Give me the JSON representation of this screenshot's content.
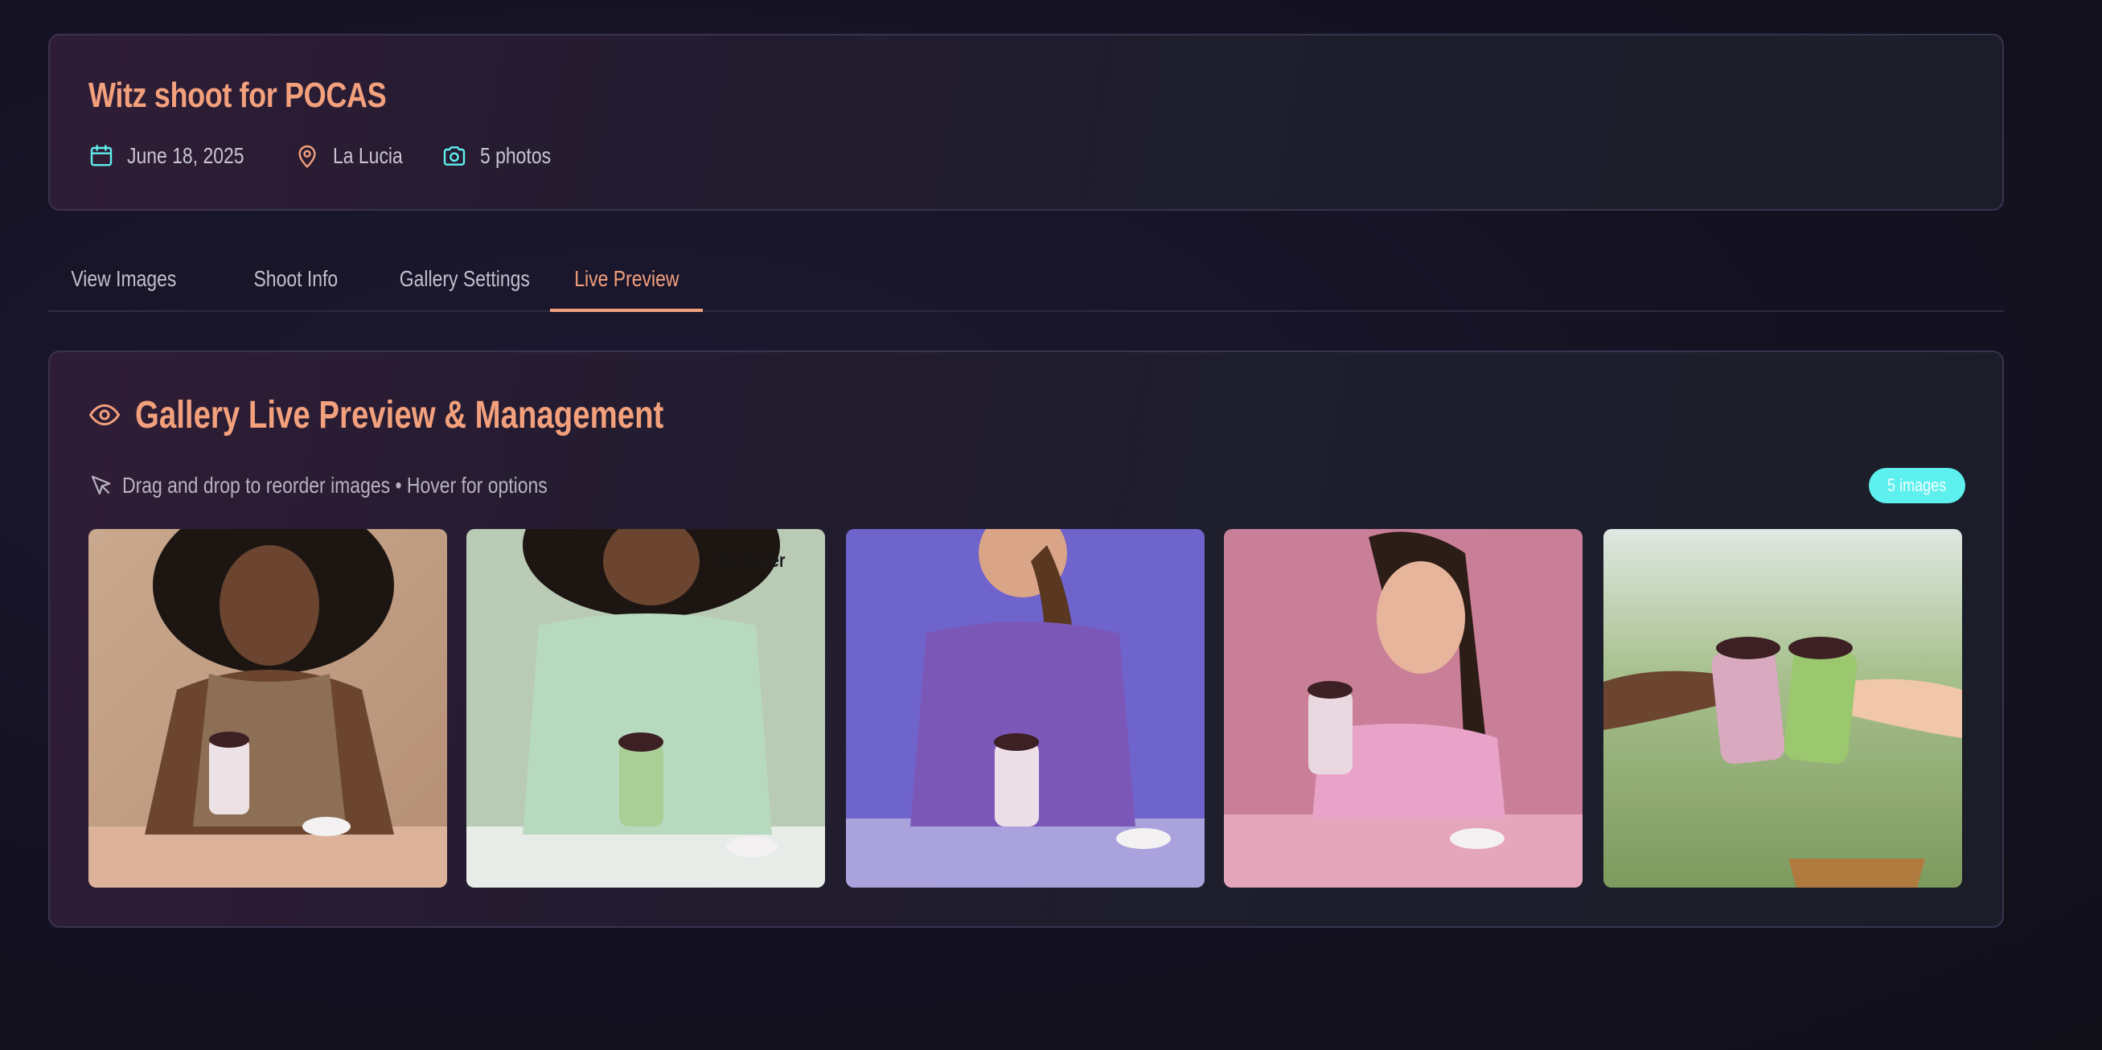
{
  "shoot": {
    "title": "Witz shoot for POCAS",
    "date": "June 18, 2025",
    "location": "La Lucia",
    "photo_count": "5 photos"
  },
  "tabs": [
    {
      "label": "View Images",
      "active": false
    },
    {
      "label": "Shoot Info",
      "active": false
    },
    {
      "label": "Gallery Settings",
      "active": false
    },
    {
      "label": "Live Preview",
      "active": true
    }
  ],
  "gallery": {
    "title": "Gallery Live Preview & Management",
    "hint": "Drag and drop to reorder images • Hover for options",
    "count_badge": "5 images",
    "images": [
      {
        "cover": false
      },
      {
        "cover": true,
        "cover_label": "Cover"
      },
      {
        "cover": false
      },
      {
        "cover": false
      },
      {
        "cover": false
      }
    ]
  },
  "icons": {
    "date": "calendar-icon",
    "location": "map-pin-icon",
    "photos": "camera-icon",
    "gallery": "eye-icon",
    "hint": "cursor-pointer-icon",
    "cover": "crown-icon"
  },
  "colors": {
    "accent": "#f3a07c",
    "teal": "#5ef0ee",
    "background": "#141221"
  }
}
